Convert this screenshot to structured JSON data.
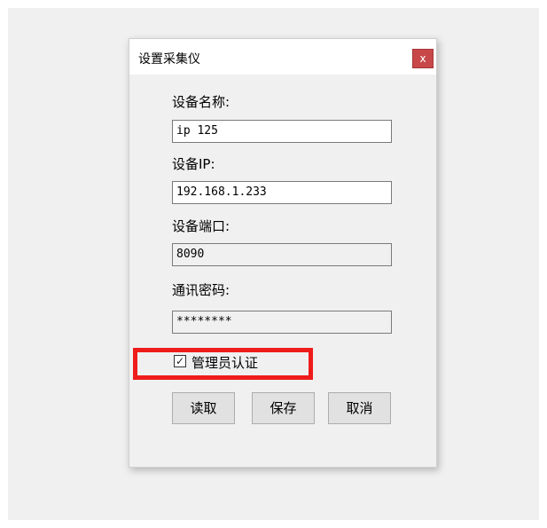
{
  "dialog": {
    "title": "设置采集仪",
    "close_label": "x"
  },
  "form": {
    "device_name": {
      "label": "设备名称:",
      "value": "ip 125"
    },
    "device_ip": {
      "label": "设备IP:",
      "value": "192.168.1.233"
    },
    "device_port": {
      "label": "设备端口:",
      "value": "8090"
    },
    "password": {
      "label": "通讯密码:",
      "value": "********"
    },
    "admin_auth": {
      "label": "管理员认证",
      "checked": true,
      "check_glyph": "✓"
    }
  },
  "buttons": {
    "read": "读取",
    "save": "保存",
    "cancel": "取消"
  },
  "colors": {
    "highlight": "#ee1c1c",
    "close_button": "#c8484a"
  }
}
